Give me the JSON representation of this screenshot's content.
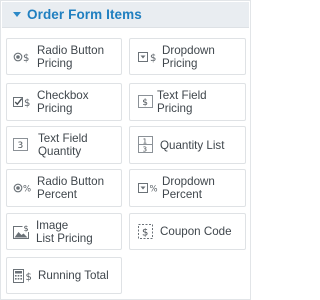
{
  "panel": {
    "title": "Order Form Items",
    "accent_color": "#1f7fc0",
    "items": [
      {
        "label_line1": "Radio Button",
        "label_line2": "Pricing",
        "icon": "radio-dollar-icon"
      },
      {
        "label_line1": "Dropdown",
        "label_line2": "Pricing",
        "icon": "dropdown-dollar-icon"
      },
      {
        "label_line1": "Checkbox",
        "label_line2": "Pricing",
        "icon": "checkbox-dollar-icon"
      },
      {
        "label_line1": "Text Field",
        "label_line2": "Pricing",
        "icon": "textfield-dollar-icon"
      },
      {
        "label_line1": "Text Field",
        "label_line2": "Quantity",
        "icon": "textfield-number-icon"
      },
      {
        "label_line1": "Quantity List",
        "label_line2": "",
        "icon": "quantity-list-icon"
      },
      {
        "label_line1": "Radio Button",
        "label_line2": "Percent",
        "icon": "radio-percent-icon"
      },
      {
        "label_line1": "Dropdown",
        "label_line2": "Percent",
        "icon": "dropdown-percent-icon"
      },
      {
        "label_line1": "Image",
        "label_line2": "List Pricing",
        "icon": "image-dollar-icon"
      },
      {
        "label_line1": "Coupon Code",
        "label_line2": "",
        "icon": "coupon-dollar-icon"
      },
      {
        "label_line1": "Running Total",
        "label_line2": "",
        "icon": "calculator-dollar-icon"
      }
    ]
  }
}
